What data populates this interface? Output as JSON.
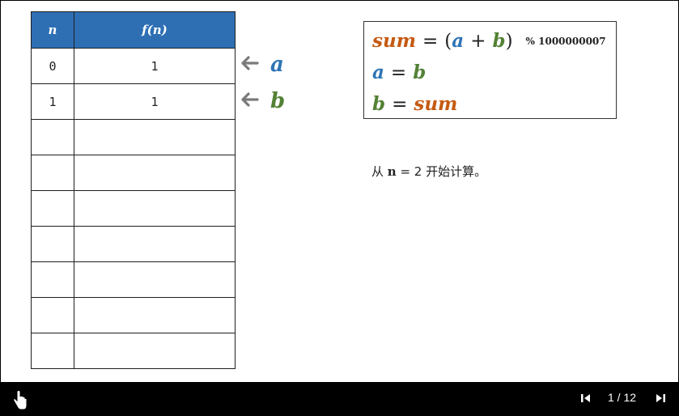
{
  "table": {
    "headers": [
      "n",
      "f(n)"
    ],
    "rows": [
      [
        "0",
        "1"
      ],
      [
        "1",
        "1"
      ],
      [
        "",
        ""
      ],
      [
        "",
        ""
      ],
      [
        "",
        ""
      ],
      [
        "",
        ""
      ],
      [
        "",
        ""
      ],
      [
        "",
        ""
      ],
      [
        "",
        ""
      ]
    ]
  },
  "pointers": {
    "a": {
      "arrow": "🡐",
      "label": "a"
    },
    "b": {
      "arrow": "🡐",
      "label": "b"
    }
  },
  "formula": {
    "line1": {
      "sum": "sum",
      "eq": "=",
      "lparen": "(",
      "a": "a",
      "plus": "+",
      "b": "b",
      "rparen": ")",
      "mod": "% 1000000007"
    },
    "line2": {
      "a": "a",
      "eq": "=",
      "b": "b"
    },
    "line3": {
      "b": "b",
      "eq": "=",
      "sum": "sum"
    }
  },
  "note": {
    "prefix": "从 ",
    "var": "n",
    "suffix": " = 2 开始计算。"
  },
  "player": {
    "page": "1 / 12"
  },
  "colors": {
    "header_bg": "#2e6fb4",
    "a": "#2e74b5",
    "b": "#538135",
    "sum": "#c55a11"
  }
}
